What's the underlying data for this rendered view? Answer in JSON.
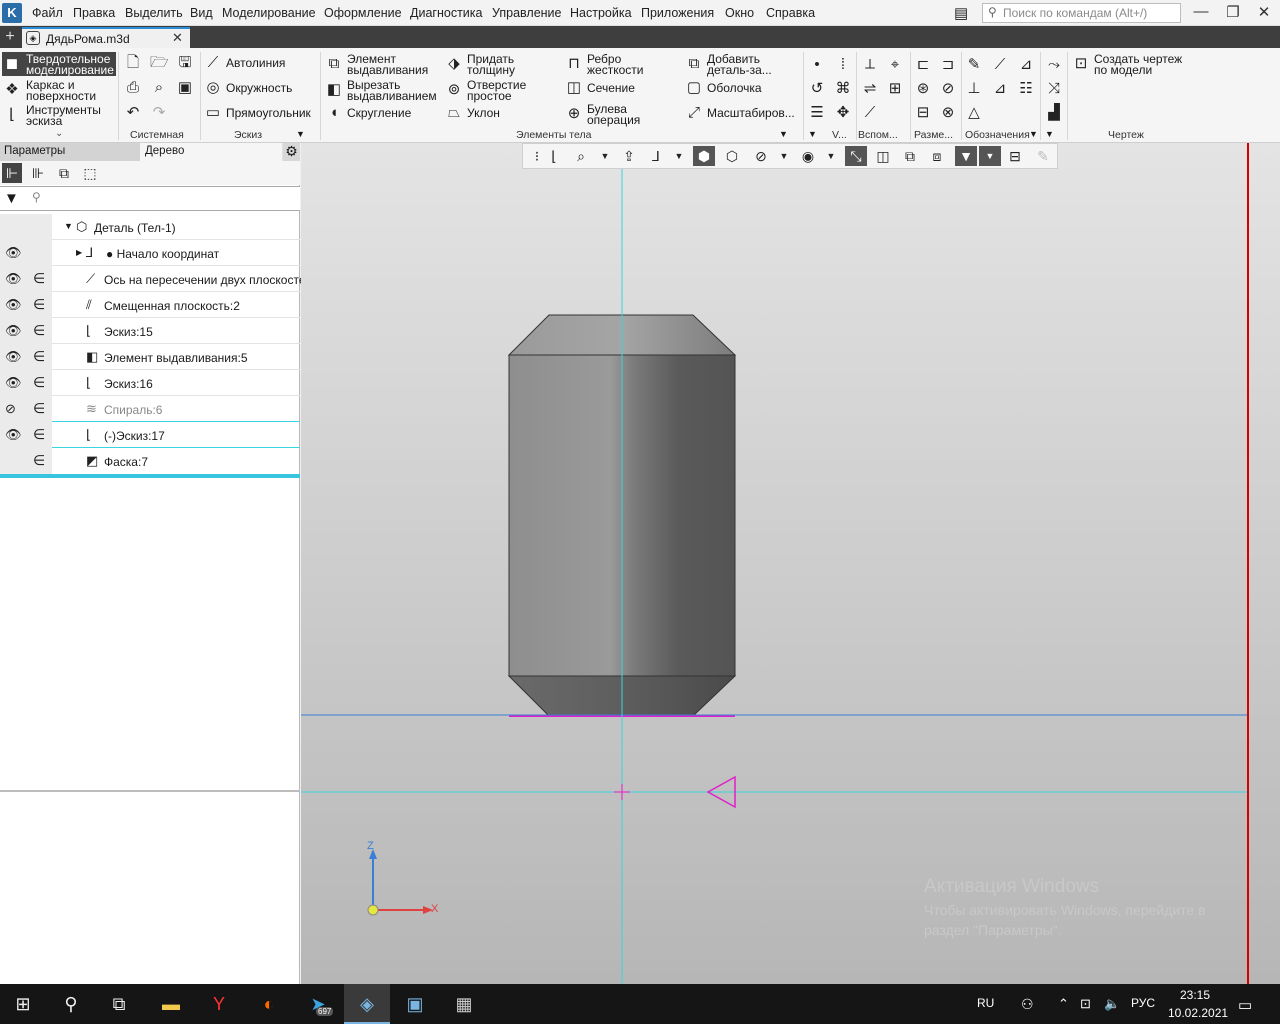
{
  "menu": {
    "items": [
      "Файл",
      "Правка",
      "Выделить",
      "Вид",
      "Моделирование",
      "Оформление",
      "Диагностика",
      "Управление",
      "Настройка",
      "Приложения",
      "Окно",
      "Справка"
    ],
    "search_placeholder": "Поиск по командам (Alt+/)"
  },
  "document": {
    "tab_title": "ДядьРома.m3d"
  },
  "ribbon": {
    "modes": [
      "Твердотельное моделирование",
      "Каркас и поверхности",
      "Инструменты эскиза"
    ],
    "sketch": [
      "Автолиния",
      "Окружность",
      "Прямоугольник"
    ],
    "body_col1": [
      "Элемент выдавливания",
      "Вырезать выдавливанием",
      "Скругление"
    ],
    "body_col2": [
      "Придать толщину",
      "Отверстие простое",
      "Уклон"
    ],
    "body_col3": [
      "Ребро жесткости",
      "Сечение",
      "Булева операция"
    ],
    "body_col4": [
      "Добавить деталь-за...",
      "Оболочка",
      "Масштабиров..."
    ],
    "drawing": "Создать чертеж по модели",
    "groups": {
      "system": "Системная",
      "sketch": "Эскиз",
      "body": "Элементы тела",
      "v": "V...",
      "aux": "Вспом...",
      "dims": "Разме...",
      "designations": "Обозначения",
      "drawing": "Чертеж"
    }
  },
  "panel": {
    "tab_params": "Параметры",
    "tab_tree": "Дерево",
    "tree": {
      "root": "Деталь (Тел-1)",
      "nodes": [
        {
          "label": "Начало координат",
          "icon": "origin-icon"
        },
        {
          "label": "Ось на пересечении двух плоскосте",
          "icon": "axis-icon"
        },
        {
          "label": "Смещенная плоскость:2",
          "icon": "plane-icon"
        },
        {
          "label": "Эскиз:15",
          "icon": "sketch-icon"
        },
        {
          "label": "Элемент выдавливания:5",
          "icon": "extrude-icon"
        },
        {
          "label": "Эскиз:16",
          "icon": "sketch-icon"
        },
        {
          "label": "Спираль:6",
          "icon": "spiral-icon"
        },
        {
          "label": "(-)Эскиз:17",
          "icon": "sketch-icon"
        },
        {
          "label": "Фаска:7",
          "icon": "chamfer-icon"
        }
      ]
    }
  },
  "viewport": {
    "axis_z": "Z",
    "axis_x": "X",
    "watermark_title": "Активация Windows",
    "watermark_text": "Чтобы активировать Windows, перейдите в раздел \"Параметры\"."
  },
  "taskbar": {
    "lang": "RU",
    "keyboard": "РУС",
    "time": "23:15",
    "date": "10.02.2021",
    "telegram_badge": "697"
  },
  "colors": {
    "accent": "#2a8bd6",
    "cyan_line": "#39d4e0",
    "blue_line": "#3a7fd6",
    "magenta": "#e020c8",
    "red_border": "#d40000"
  }
}
